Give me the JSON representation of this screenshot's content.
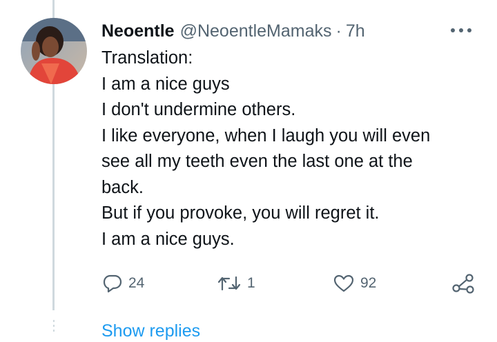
{
  "tweet": {
    "display_name": "Neoentle",
    "handle": "@NeoentleMamaks",
    "separator": "·",
    "time": "7h",
    "lines": [
      "Translation:",
      "I am a nice guys",
      "I don't undermine others.",
      "I like everyone, when I laugh you will even",
      "see all my teeth even the last one at the",
      "back.",
      "But if you provoke, you will regret it.",
      "I am a nice guys."
    ]
  },
  "actions": {
    "replies": "24",
    "retweets": "1",
    "likes": "92"
  },
  "icons": {
    "more": "more-horizontal-icon",
    "reply": "reply-icon",
    "retweet": "retweet-icon",
    "like": "heart-icon",
    "share": "share-icon"
  },
  "show_replies": "Show replies",
  "colors": {
    "link": "#1d9bf0",
    "secondary": "#536471",
    "thread_line": "#cfd9de"
  }
}
